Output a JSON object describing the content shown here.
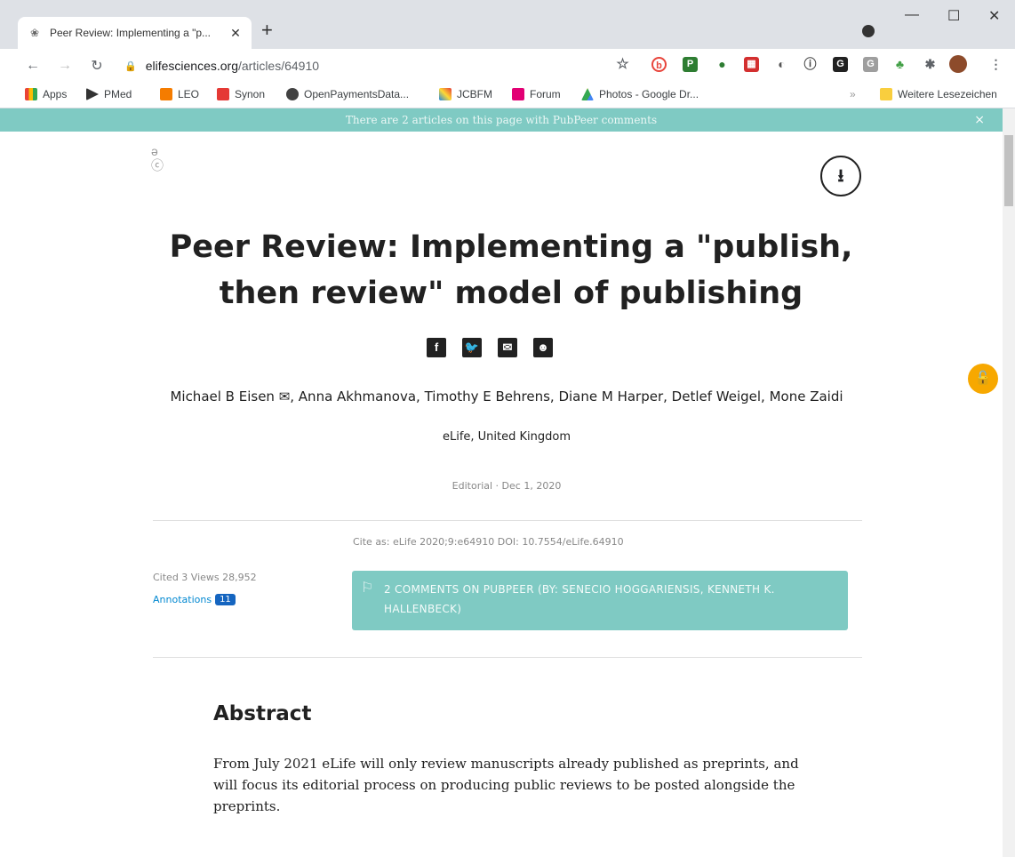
{
  "browser": {
    "tab_title": "Peer Review: Implementing a \"p...",
    "tab_close": "✕",
    "new_tab": "+",
    "win_min": "—",
    "win_max": "☐",
    "win_close": "✕",
    "url_domain": "elifesciences.org",
    "url_path": "/articles/64910",
    "bookmarks": [
      "Apps",
      "PMed",
      "LEO",
      "Synon",
      "OpenPaymentsData...",
      "JCBFM",
      "Forum",
      "Photos - Google Dr..."
    ],
    "bookmarks_overflow": "»",
    "other_bookmarks": "Weitere Lesezeichen",
    "colors": {
      "titlebar": "#dee1e6",
      "accent_teal": "#7fcac3",
      "lock_fab": "#f7a800"
    }
  },
  "pubpeer": {
    "banner": "There are 2 articles on this page with PubPeer comments",
    "close": "×",
    "comments_box": "2 COMMENTS ON PUBPEER (BY: SENECIO HOGGARIENSIS, KENNETH K. HALLENBECK)"
  },
  "article": {
    "title": "Peer Review: Implementing a \"publish, then review\" model of publishing",
    "authors": "Michael B Eisen ✉, Anna Akhmanova, Timothy E Behrens, Diane M Harper, Detlef Weigel, Mone Zaidi",
    "affiliation": "eLife, United Kingdom",
    "meta": "Editorial · Dec 1, 2020",
    "cite": "Cite as: eLife 2020;9:e64910   DOI: 10.7554/eLife.64910",
    "stats": "Cited 3  Views 28,952",
    "annotations_label": "Annotations",
    "annotations_count": "11",
    "abstract_heading": "Abstract",
    "abstract_text": "From July 2021 eLife will only review manuscripts already published as preprints, and will focus its editorial process on producing public reviews to be posted alongside the preprints."
  }
}
